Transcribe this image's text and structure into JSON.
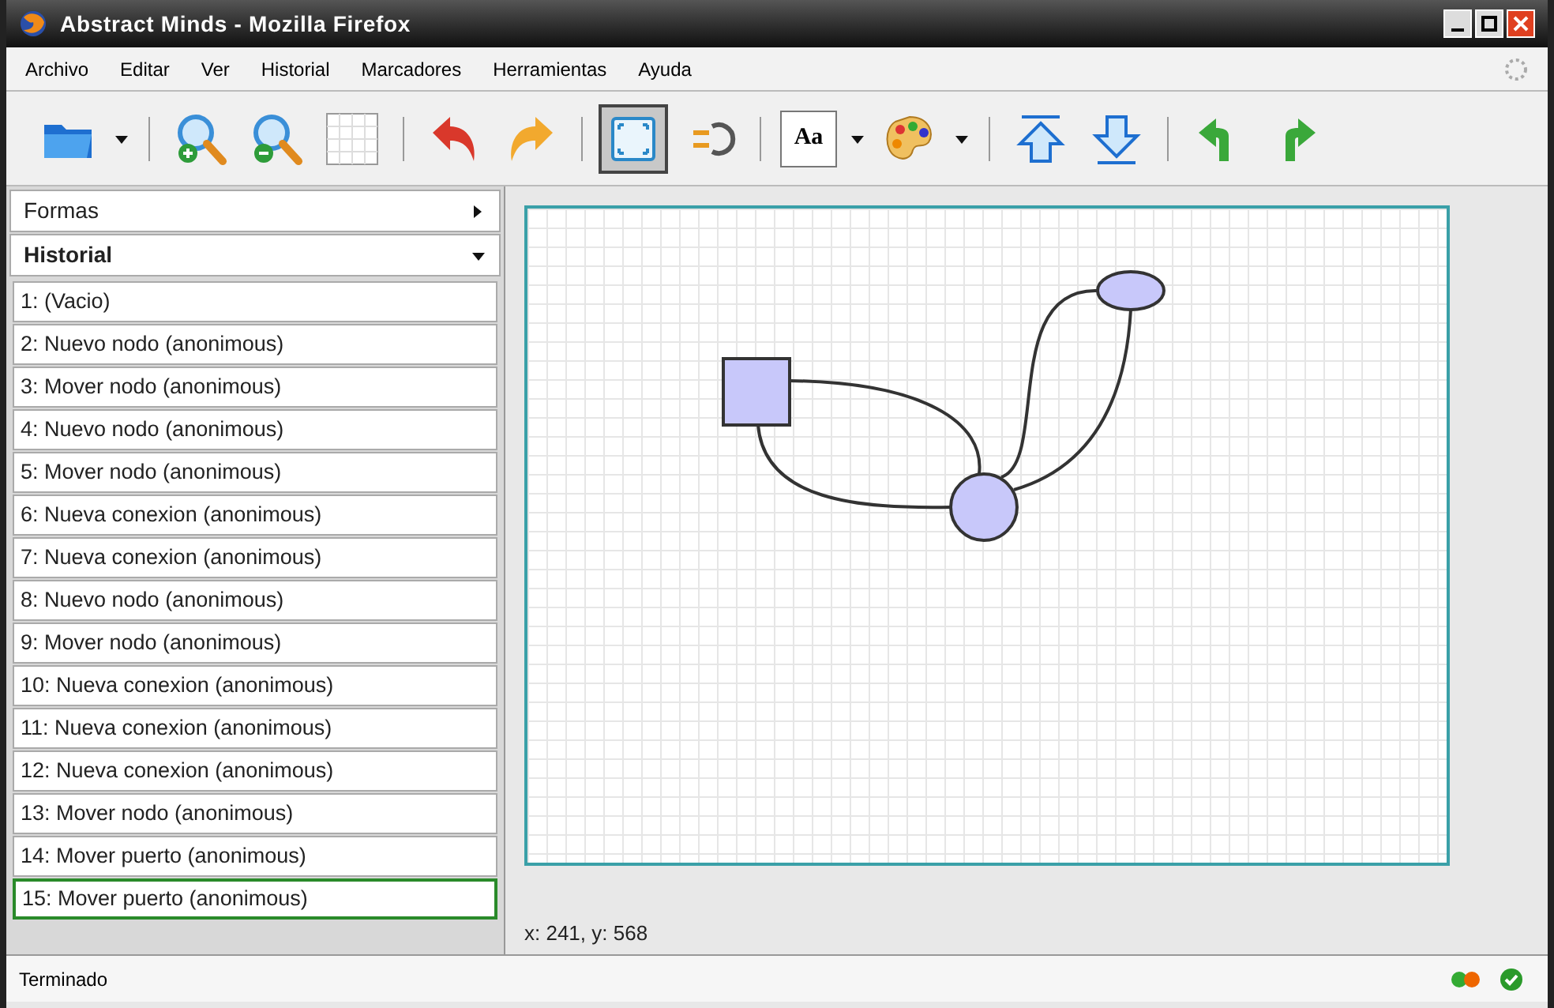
{
  "window": {
    "title": "Abstract Minds - Mozilla Firefox"
  },
  "menu": [
    "Archivo",
    "Editar",
    "Ver",
    "Historial",
    "Marcadores",
    "Herramientas",
    "Ayuda"
  ],
  "toolbar": [
    {
      "kind": "folder"
    },
    {
      "kind": "caret"
    },
    {
      "kind": "sep"
    },
    {
      "kind": "zoom-in"
    },
    {
      "kind": "zoom-out"
    },
    {
      "kind": "grid",
      "pressed": false
    },
    {
      "kind": "sep"
    },
    {
      "kind": "undo"
    },
    {
      "kind": "redo"
    },
    {
      "kind": "sep"
    },
    {
      "kind": "fit",
      "pressed": true
    },
    {
      "kind": "plug"
    },
    {
      "kind": "sep"
    },
    {
      "kind": "text",
      "label": "Aa"
    },
    {
      "kind": "caret"
    },
    {
      "kind": "palette"
    },
    {
      "kind": "caret"
    },
    {
      "kind": "sep"
    },
    {
      "kind": "up"
    },
    {
      "kind": "down"
    },
    {
      "kind": "sep"
    },
    {
      "kind": "turn-left"
    },
    {
      "kind": "turn-right"
    }
  ],
  "sidebar": {
    "sections": [
      {
        "label": "Formas",
        "expanded": false
      },
      {
        "label": "Historial",
        "expanded": true
      }
    ],
    "history": [
      {
        "label": "1: (Vacio)",
        "selected": false
      },
      {
        "label": "2: Nuevo nodo (anonimous)",
        "selected": false
      },
      {
        "label": "3: Mover nodo (anonimous)",
        "selected": false
      },
      {
        "label": "4: Nuevo nodo (anonimous)",
        "selected": false
      },
      {
        "label": "5: Mover nodo (anonimous)",
        "selected": false
      },
      {
        "label": "6: Nueva conexion (anonimous)",
        "selected": false
      },
      {
        "label": "7: Nueva conexion (anonimous)",
        "selected": false
      },
      {
        "label": "8: Nuevo nodo (anonimous)",
        "selected": false
      },
      {
        "label": "9: Mover nodo (anonimous)",
        "selected": false
      },
      {
        "label": "10: Nueva conexion (anonimous)",
        "selected": false
      },
      {
        "label": "11: Nueva conexion (anonimous)",
        "selected": false
      },
      {
        "label": "12: Nueva conexion (anonimous)",
        "selected": false
      },
      {
        "label": "13: Mover nodo (anonimous)",
        "selected": false
      },
      {
        "label": "14: Mover puerto (anonimous)",
        "selected": false
      },
      {
        "label": "15: Mover puerto (anonimous)",
        "selected": true
      }
    ]
  },
  "canvas": {
    "nodes": [
      {
        "kind": "square"
      },
      {
        "kind": "circle"
      },
      {
        "kind": "ellipse"
      }
    ],
    "coordinates": "x: 241, y: 568"
  },
  "status_bar": {
    "text": "Terminado"
  }
}
